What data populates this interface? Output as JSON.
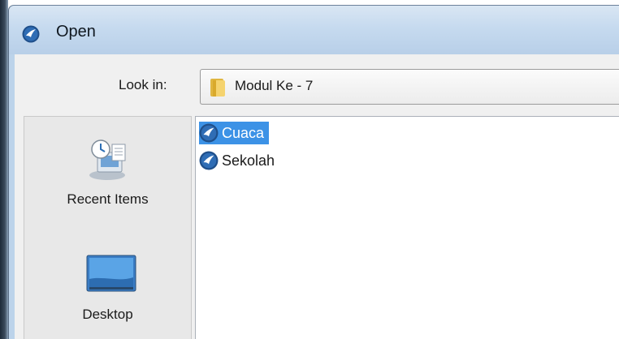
{
  "window": {
    "title": "Open",
    "title_icon": "app-logo-icon"
  },
  "lookin": {
    "label": "Look in:",
    "value": "Modul Ke - 7",
    "icon": "folder-icon"
  },
  "places": [
    {
      "label": "Recent Items",
      "icon": "recent-items-icon"
    },
    {
      "label": "Desktop",
      "icon": "desktop-icon"
    }
  ],
  "files": [
    {
      "name": "Cuaca",
      "icon": "app-logo-icon",
      "selected": true
    },
    {
      "name": "Sekolah",
      "icon": "app-logo-icon",
      "selected": false
    }
  ],
  "colors": {
    "selection": "#3c92e6",
    "titlebar": "#c6daef",
    "client": "#f0f0f0"
  }
}
